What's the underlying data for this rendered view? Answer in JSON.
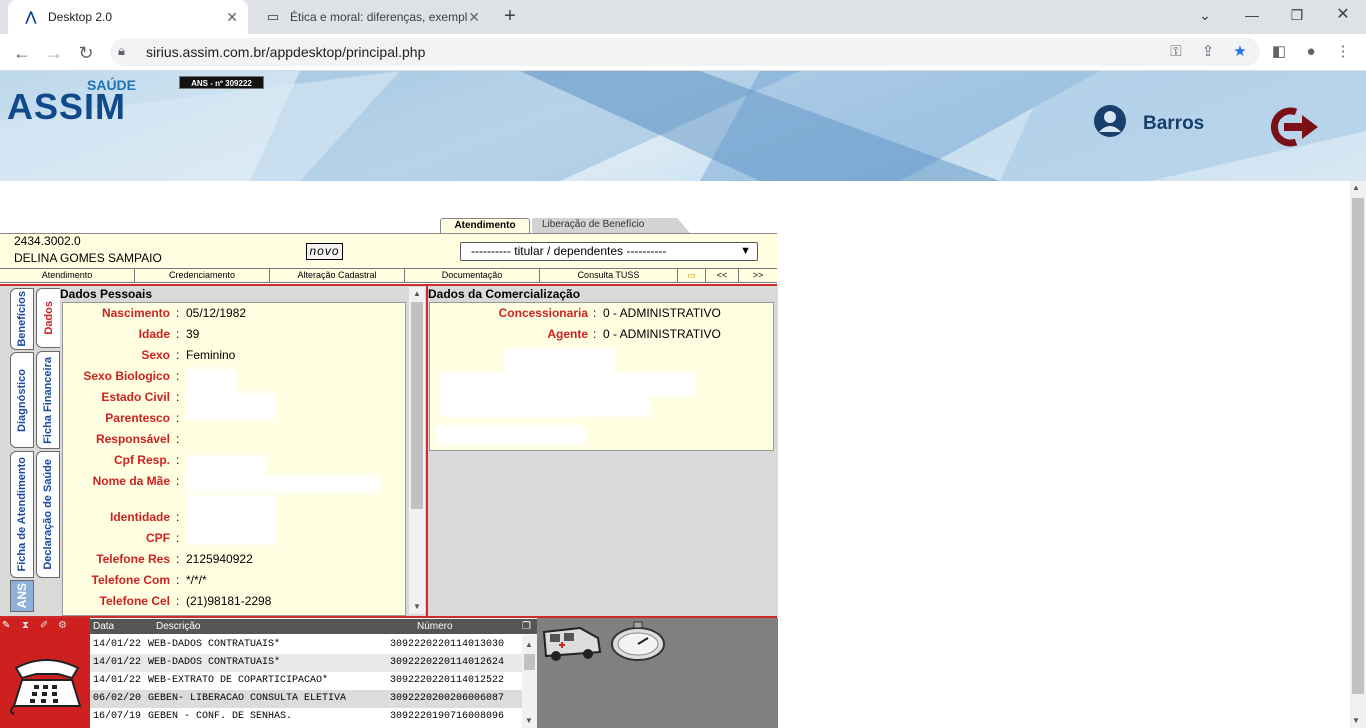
{
  "browser": {
    "tabs": [
      {
        "title": "Desktop 2.0",
        "icon": "assim-favicon"
      },
      {
        "title": "Ética e moral: diferenças, exempl",
        "icon": "page-favicon"
      }
    ],
    "url": "sirius.assim.com.br/appdesktop/principal.php"
  },
  "header": {
    "logo_top": "SAÚDE",
    "logo_main": "ASSIM",
    "ans_badge": "ANS - nº 309222",
    "username": "Barros"
  },
  "top_tabs": {
    "active": "Atendimento",
    "other": "Liberação de Benefício"
  },
  "beneficiary": {
    "card": "2434.3002.0",
    "name": "DELINA GOMES SAMPAIO",
    "novo": "novo",
    "select_value": "---------- titular / dependentes ----------"
  },
  "menu": [
    "Atendimento",
    "Credenciamento",
    "Alteração Cadastral",
    "Documentação",
    "Consulta TUSS",
    "<<",
    ">>"
  ],
  "vertical_tabs": {
    "col1": [
      "Benefícios",
      "Diagnóstico",
      "Ficha de Atendimento"
    ],
    "col2": [
      "Dados",
      "Ficha Financeira",
      "Declaração de Saúde"
    ],
    "ans": "ANS"
  },
  "dados_pessoais": {
    "title": "Dados Pessoais",
    "rows": [
      {
        "label": "Nascimento",
        "value": "05/12/1982"
      },
      {
        "label": "Idade",
        "value": "39"
      },
      {
        "label": "Sexo",
        "value": "Feminino"
      },
      {
        "label": "Sexo Biologico",
        "value": ""
      },
      {
        "label": "Estado Civil",
        "value": ""
      },
      {
        "label": "Parentesco",
        "value": ""
      },
      {
        "label": "Responsável",
        "value": ""
      },
      {
        "label": "Cpf Resp.",
        "value": ""
      },
      {
        "label": "Nome da Mãe",
        "value": ""
      },
      {
        "label": "Identidade",
        "value": ""
      },
      {
        "label": "CPF",
        "value": ""
      },
      {
        "label": "Telefone Res",
        "value": "2125940922"
      },
      {
        "label": "Telefone Com",
        "value": "*/*/*"
      },
      {
        "label": "Telefone Cel",
        "value": "(21)98181-2298"
      }
    ]
  },
  "comercializacao": {
    "title": "Dados da Comercialização",
    "rows": [
      {
        "label": "Concessionaria",
        "value": "0 - ADMINISTRATIVO"
      },
      {
        "label": "Agente",
        "value": "0 - ADMINISTRATIVO"
      }
    ]
  },
  "history": {
    "headers": {
      "data": "Data",
      "descricao": "Descrição",
      "numero": "Número"
    },
    "rows": [
      {
        "data": "14/01/22",
        "descricao": "WEB-DADOS CONTRATUAIS*",
        "numero": "3092220220114013030"
      },
      {
        "data": "14/01/22",
        "descricao": "WEB-DADOS CONTRATUAIS*",
        "numero": "3092220220114012624"
      },
      {
        "data": "14/01/22",
        "descricao": "WEB-EXTRATO DE COPARTICIPACAO*",
        "numero": "3092220220114012522"
      },
      {
        "data": "06/02/20",
        "descricao": "GEBEN- LIBERACAO CONSULTA ELETIVA",
        "numero": "3092220200206006087"
      },
      {
        "data": "16/07/19",
        "descricao": "GEBEN - CONF. DE SENHAS.",
        "numero": "3092220190716008096"
      }
    ]
  },
  "colors": {
    "accent_red": "#cc2c2c",
    "panel_yellow": "#fffee0",
    "brand_blue": "#114a8b"
  }
}
